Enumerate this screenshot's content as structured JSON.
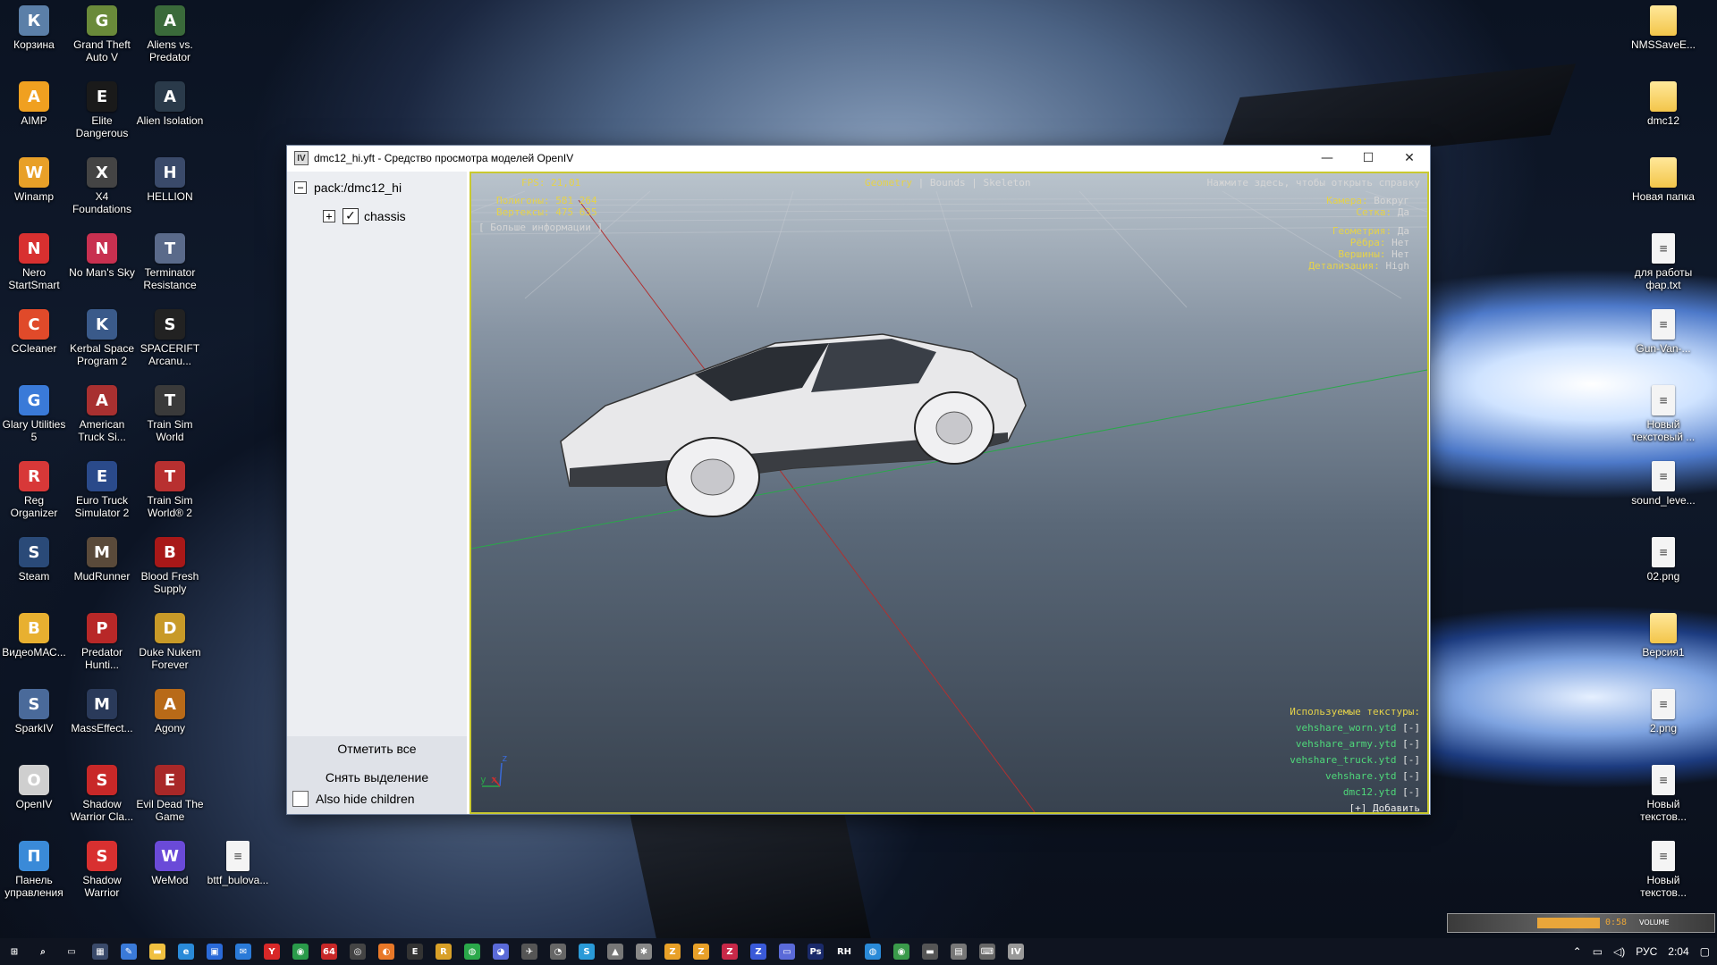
{
  "desktop": {
    "icons_col1": [
      {
        "label": "Корзина",
        "icon": "recycle-bin-icon",
        "color": "#5b7fa8"
      },
      {
        "label": "AIMP",
        "icon": "aimp-icon",
        "color": "#f0a020"
      },
      {
        "label": "Winamp",
        "icon": "winamp-icon",
        "color": "#e8a028"
      },
      {
        "label": "Nero StartSmart",
        "icon": "nero-icon",
        "color": "#d83030"
      },
      {
        "label": "CCleaner",
        "icon": "ccleaner-icon",
        "color": "#e04a2a"
      },
      {
        "label": "Glary Utilities 5",
        "icon": "glary-icon",
        "color": "#3a7ad8"
      },
      {
        "label": "Reg Organizer",
        "icon": "reg-organizer-icon",
        "color": "#d83838"
      },
      {
        "label": "Steam",
        "icon": "steam-icon",
        "color": "#2a4a78"
      },
      {
        "label": "ВидеоМАС...",
        "icon": "videomaster-icon",
        "color": "#e8b030"
      },
      {
        "label": "SparkIV",
        "icon": "sparkiv-icon",
        "color": "#4a6a9a"
      },
      {
        "label": "OpenIV",
        "icon": "openiv-icon",
        "color": "#cfcfcf"
      },
      {
        "label": "Панель управления",
        "icon": "control-panel-icon",
        "color": "#3a8ad8"
      }
    ],
    "icons_col2": [
      {
        "label": "Grand Theft Auto V",
        "icon": "gta5-icon",
        "color": "#6a8a3a"
      },
      {
        "label": "Elite Dangerous",
        "icon": "elite-icon",
        "color": "#1a1a1a"
      },
      {
        "label": "X4 Foundations",
        "icon": "x4-icon",
        "color": "#444"
      },
      {
        "label": "No Man's Sky",
        "icon": "nms-icon",
        "color": "#c83050"
      },
      {
        "label": "Kerbal Space Program 2",
        "icon": "ksp2-icon",
        "color": "#3a5a8a"
      },
      {
        "label": "American Truck Si...",
        "icon": "ats-icon",
        "color": "#a83030"
      },
      {
        "label": "Euro Truck Simulator 2",
        "icon": "ets2-icon",
        "color": "#2a4a8a"
      },
      {
        "label": "MudRunner",
        "icon": "mudrunner-icon",
        "color": "#5a4a3a"
      },
      {
        "label": "Predator Hunti...",
        "icon": "predator-icon",
        "color": "#b82828"
      },
      {
        "label": "MassEffect...",
        "icon": "masseffect-icon",
        "color": "#2a3a5a"
      },
      {
        "label": "Shadow Warrior Cla...",
        "icon": "shadow-warrior-icon",
        "color": "#c82828"
      },
      {
        "label": "Shadow Warrior",
        "icon": "shadow-warrior-2-icon",
        "color": "#d83030"
      }
    ],
    "icons_col3": [
      {
        "label": "Aliens vs. Predator",
        "icon": "avp-icon",
        "color": "#3a6a3a"
      },
      {
        "label": "Alien Isolation",
        "icon": "alien-icon",
        "color": "#2a3a4a"
      },
      {
        "label": "HELLION",
        "icon": "hellion-icon",
        "color": "#3a4a6a"
      },
      {
        "label": "Terminator Resistance",
        "icon": "terminator-icon",
        "color": "#5a6a8a"
      },
      {
        "label": "SPACERIFT Arcanu...",
        "icon": "spacerift-icon",
        "color": "#222"
      },
      {
        "label": "Train Sim World",
        "icon": "tsw-icon",
        "color": "#3a3a3a"
      },
      {
        "label": "Train Sim World® 2",
        "icon": "tsw2-icon",
        "color": "#b83030"
      },
      {
        "label": "Blood Fresh Supply",
        "icon": "blood-icon",
        "color": "#a81818"
      },
      {
        "label": "Duke Nukem Forever",
        "icon": "duke-icon",
        "color": "#c89a28"
      },
      {
        "label": "Agony",
        "icon": "agony-icon",
        "color": "#b86a18"
      },
      {
        "label": "Evil Dead The Game",
        "icon": "evil-dead-icon",
        "color": "#a82828"
      },
      {
        "label": "WeMod",
        "icon": "wemod-icon",
        "color": "#6a4ad8"
      }
    ],
    "icon_col4": {
      "label": "bttf_bulova...",
      "icon": "text-file-icon"
    },
    "icons_right": [
      {
        "label": "NMSSaveE...",
        "icon": "folder-icon",
        "kind": "folder"
      },
      {
        "label": "dmc12",
        "icon": "folder-icon",
        "kind": "folder"
      },
      {
        "label": "Новая папка",
        "icon": "folder-icon",
        "kind": "folder"
      },
      {
        "label": "для работы фар.txt",
        "icon": "text-file-icon",
        "kind": "doc"
      },
      {
        "label": "Gun-Van-...",
        "icon": "image-file-icon",
        "kind": "doc"
      },
      {
        "label": "Новый текстовый ...",
        "icon": "text-file-icon",
        "kind": "doc"
      },
      {
        "label": "sound_leve...",
        "icon": "text-file-icon",
        "kind": "doc"
      },
      {
        "label": "02.png",
        "icon": "image-file-icon",
        "kind": "doc"
      },
      {
        "label": "Версия1",
        "icon": "folder-icon",
        "kind": "folder"
      },
      {
        "label": "2.png",
        "icon": "image-file-icon",
        "kind": "doc"
      },
      {
        "label": "Новый текстов...",
        "icon": "text-file-icon",
        "kind": "doc"
      },
      {
        "label": "Новый текстов...",
        "icon": "text-file-icon",
        "kind": "doc"
      }
    ]
  },
  "window": {
    "title": "dmc12_hi.yft - Средство просмотра моделей OpenIV",
    "app_icon": "IV",
    "minimize": "—",
    "maximize": "☐",
    "close": "✕"
  },
  "tree": {
    "root_label": "pack:/dmc12_hi",
    "root_toggle": "−",
    "child_toggle": "+",
    "child_label": "chassis",
    "child_checked": "✓"
  },
  "sidebar_actions": {
    "select_all": "Отметить все",
    "deselect": "Снять выделение",
    "also_hide_children": "Also hide children"
  },
  "viewport": {
    "fps_label": "FPS:",
    "fps_value": "21,01",
    "polygons_label": "Полигоны:",
    "polygons_value": "581 264",
    "vertices_label": "Вертексы:",
    "vertices_value": "475 635",
    "more_info": "[ Больше информации ]",
    "tab_geometry": "Geometry",
    "tab_sep": "|",
    "tab_bounds": "Bounds",
    "tab_skeleton": "Skeleton",
    "help": "Нажмите здесь, чтобы открыть справку",
    "camera_label": "Камера:",
    "camera_value": "Вокруг",
    "grid_label": "Сетка:",
    "grid_value": "Да",
    "geometry_label": "Геометрия:",
    "geometry_value": "Да",
    "edges_label": "Рёбра:",
    "edges_value": "Нет",
    "vertices2_label": "Вершины:",
    "vertices2_value": "Нет",
    "lod_label": "Детализация:",
    "lod_value": "High",
    "axis_x": "x",
    "axis_y": "y",
    "axis_z": "z",
    "textures_header": "Используемые текстуры:",
    "textures": [
      "vehshare_worn.ytd",
      "vehshare_army.ytd",
      "vehshare_truck.ytd",
      "vehshare.ytd",
      "dmc12.ytd"
    ],
    "remove_label": "[-]",
    "add_label": "[+] Добавить"
  },
  "taskbar": {
    "clock": "2:04",
    "lang": "РУС",
    "apps": [
      {
        "name": "start-icon",
        "glyph": "⊞",
        "color": "#0f1420"
      },
      {
        "name": "search-icon",
        "glyph": "⌕",
        "color": "#0f1420"
      },
      {
        "name": "task-view-icon",
        "glyph": "▭",
        "color": "#0f1420"
      },
      {
        "name": "calculator-icon",
        "glyph": "▦",
        "color": "#3a4a6a"
      },
      {
        "name": "paint-icon",
        "glyph": "✎",
        "color": "#3a7ad8"
      },
      {
        "name": "explorer-icon",
        "glyph": "▬",
        "color": "#f0c040"
      },
      {
        "name": "edge-icon",
        "glyph": "e",
        "color": "#2a8ad8"
      },
      {
        "name": "store-icon",
        "glyph": "▣",
        "color": "#2a6ad8"
      },
      {
        "name": "mail-icon",
        "glyph": "✉",
        "color": "#2a7ad8"
      },
      {
        "name": "yandex-icon",
        "glyph": "Y",
        "color": "#d82828"
      },
      {
        "name": "chrome-icon",
        "glyph": "◉",
        "color": "#2a9a4a"
      },
      {
        "name": "app64-icon",
        "glyph": "64",
        "color": "#c82828"
      },
      {
        "name": "obs-icon",
        "glyph": "◎",
        "color": "#444"
      },
      {
        "name": "firefox-icon",
        "glyph": "◐",
        "color": "#e87828"
      },
      {
        "name": "epic-icon",
        "glyph": "E",
        "color": "#333"
      },
      {
        "name": "app-r-icon",
        "glyph": "R",
        "color": "#d8a028"
      },
      {
        "name": "whatsapp-icon",
        "glyph": "◍",
        "color": "#2aa84a"
      },
      {
        "name": "discord-icon",
        "glyph": "◕",
        "color": "#5a6ad8"
      },
      {
        "name": "plane-icon",
        "glyph": "✈",
        "color": "#555"
      },
      {
        "name": "speedometer-icon",
        "glyph": "◔",
        "color": "#666"
      },
      {
        "name": "skype-icon",
        "glyph": "S",
        "color": "#2a9ad8"
      },
      {
        "name": "truck-icon",
        "glyph": "▲",
        "color": "#777"
      },
      {
        "name": "settings-app-icon",
        "glyph": "✱",
        "color": "#888"
      },
      {
        "name": "zip1-icon",
        "glyph": "Z",
        "color": "#e8a028"
      },
      {
        "name": "zip2-icon",
        "glyph": "Z",
        "color": "#e8a028"
      },
      {
        "name": "app-z3-icon",
        "glyph": "Z",
        "color": "#c82848"
      },
      {
        "name": "app-z4-icon",
        "glyph": "Z",
        "color": "#3a5ad8"
      },
      {
        "name": "monitor-icon",
        "glyph": "▭",
        "color": "#5a6ad8"
      },
      {
        "name": "photoshop-icon",
        "glyph": "Ps",
        "color": "#1a2a6a"
      },
      {
        "name": "rh-icon",
        "glyph": "RH",
        "color": "#0f1420"
      },
      {
        "name": "globe-icon",
        "glyph": "◍",
        "color": "#2a8ad8"
      },
      {
        "name": "gpu-icon",
        "glyph": "◉",
        "color": "#3a9a4a"
      },
      {
        "name": "car-icon",
        "glyph": "▬",
        "color": "#555"
      },
      {
        "name": "train-icon",
        "glyph": "▤",
        "color": "#777"
      },
      {
        "name": "keyboard-icon",
        "glyph": "⌨",
        "color": "#666"
      },
      {
        "name": "openiv-task-icon",
        "glyph": "IV",
        "color": "#999"
      }
    ]
  },
  "winamp": {
    "time": "0:58",
    "volume_label": "VOLUME"
  }
}
